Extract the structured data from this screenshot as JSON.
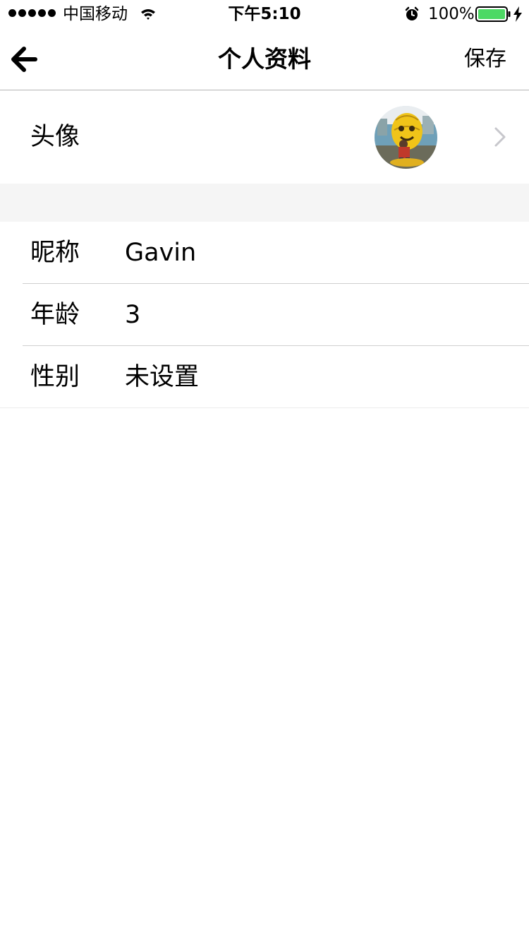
{
  "status_bar": {
    "carrier": "中国移动",
    "time": "下午5:10",
    "battery_percent": "100%",
    "battery_color": "#4cd964"
  },
  "nav": {
    "title": "个人资料",
    "save_label": "保存",
    "back_icon": "arrow-left-icon"
  },
  "avatar_row": {
    "label": "头像",
    "chevron_icon": "chevron-right-icon"
  },
  "profile_fields": [
    {
      "label": "昵称",
      "value": "Gavin"
    },
    {
      "label": "年龄",
      "value": "3"
    },
    {
      "label": "性别",
      "value": "未设置"
    }
  ]
}
